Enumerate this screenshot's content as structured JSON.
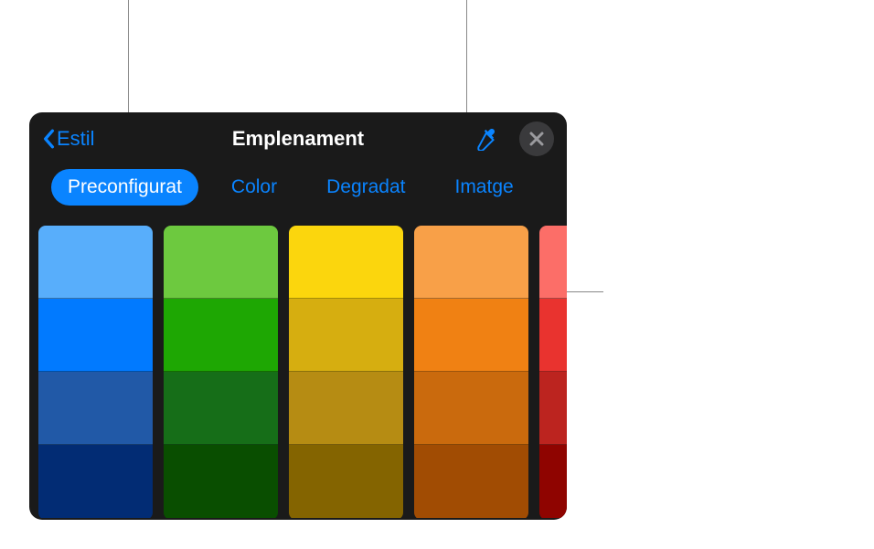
{
  "header": {
    "back_label": "Estil",
    "title": "Emplenament"
  },
  "tabs": [
    {
      "label": "Preconfigurat",
      "active": true
    },
    {
      "label": "Color",
      "active": false
    },
    {
      "label": "Degradat",
      "active": false
    },
    {
      "label": "Imatge",
      "active": false
    }
  ],
  "swatches": [
    {
      "colors": [
        "#58aefb",
        "#017aff",
        "#2159a7",
        "#022c74"
      ],
      "partial": false
    },
    {
      "colors": [
        "#6dc93f",
        "#1ea703",
        "#166e18",
        "#094e00"
      ],
      "partial": false
    },
    {
      "colors": [
        "#fbd60d",
        "#d6ae10",
        "#b68c13",
        "#846400"
      ],
      "partial": false
    },
    {
      "colors": [
        "#f8a048",
        "#f08113",
        "#ca6a0d",
        "#a14c03"
      ],
      "partial": false
    },
    {
      "colors": [
        "#fc6e68",
        "#e9332f",
        "#bc241f",
        "#8f0400"
      ],
      "partial": true
    }
  ]
}
